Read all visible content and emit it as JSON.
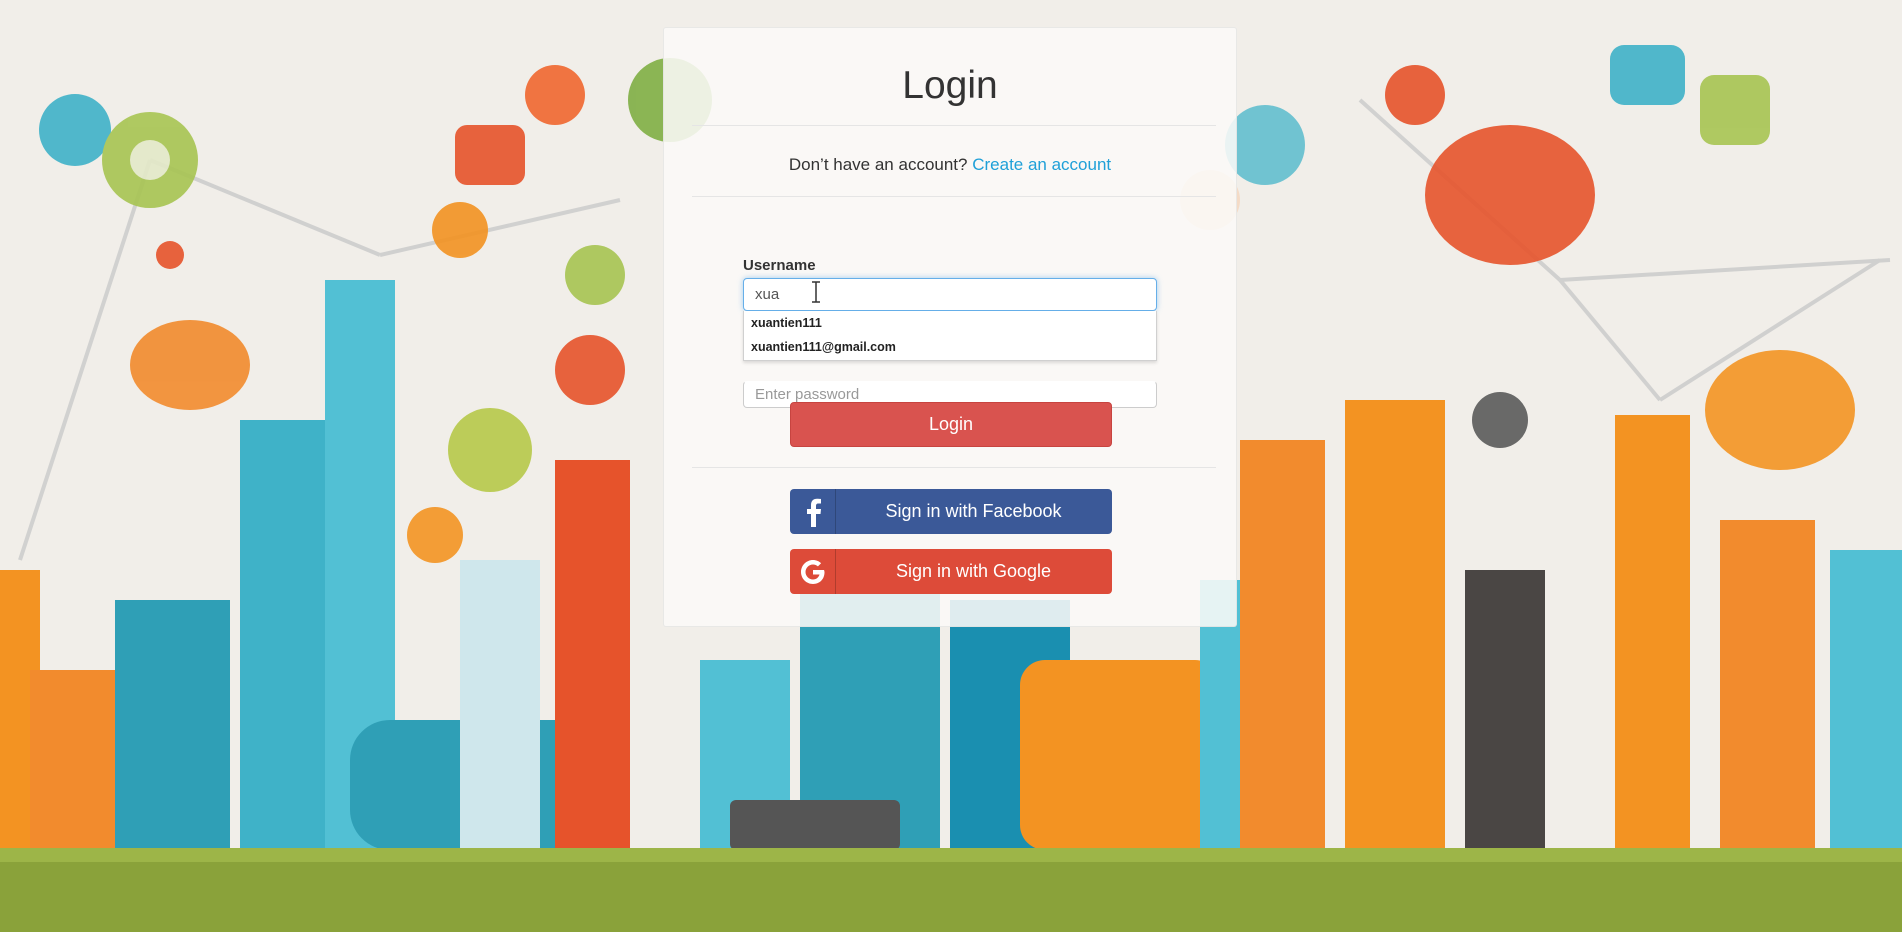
{
  "login": {
    "title": "Login",
    "signup_prompt": "Don’t have an account?",
    "signup_link": "Create an account",
    "username_label": "Username",
    "username_value": "xua",
    "password_placeholder": "Enter password",
    "login_button": "Login",
    "facebook_button": "Sign in with Facebook",
    "google_button": "Sign in with Google"
  },
  "autocomplete": {
    "items": [
      "xuantien111",
      "xuantien111@gmail.com"
    ]
  },
  "colors": {
    "login_button": "#d9534f",
    "facebook": "#3b5998",
    "google": "#dd4b39",
    "link": "#1fa0d8",
    "focus_border": "#66afe9"
  },
  "icons": {
    "facebook": "facebook-icon",
    "google": "google-icon",
    "text_cursor": "text-cursor-icon"
  }
}
